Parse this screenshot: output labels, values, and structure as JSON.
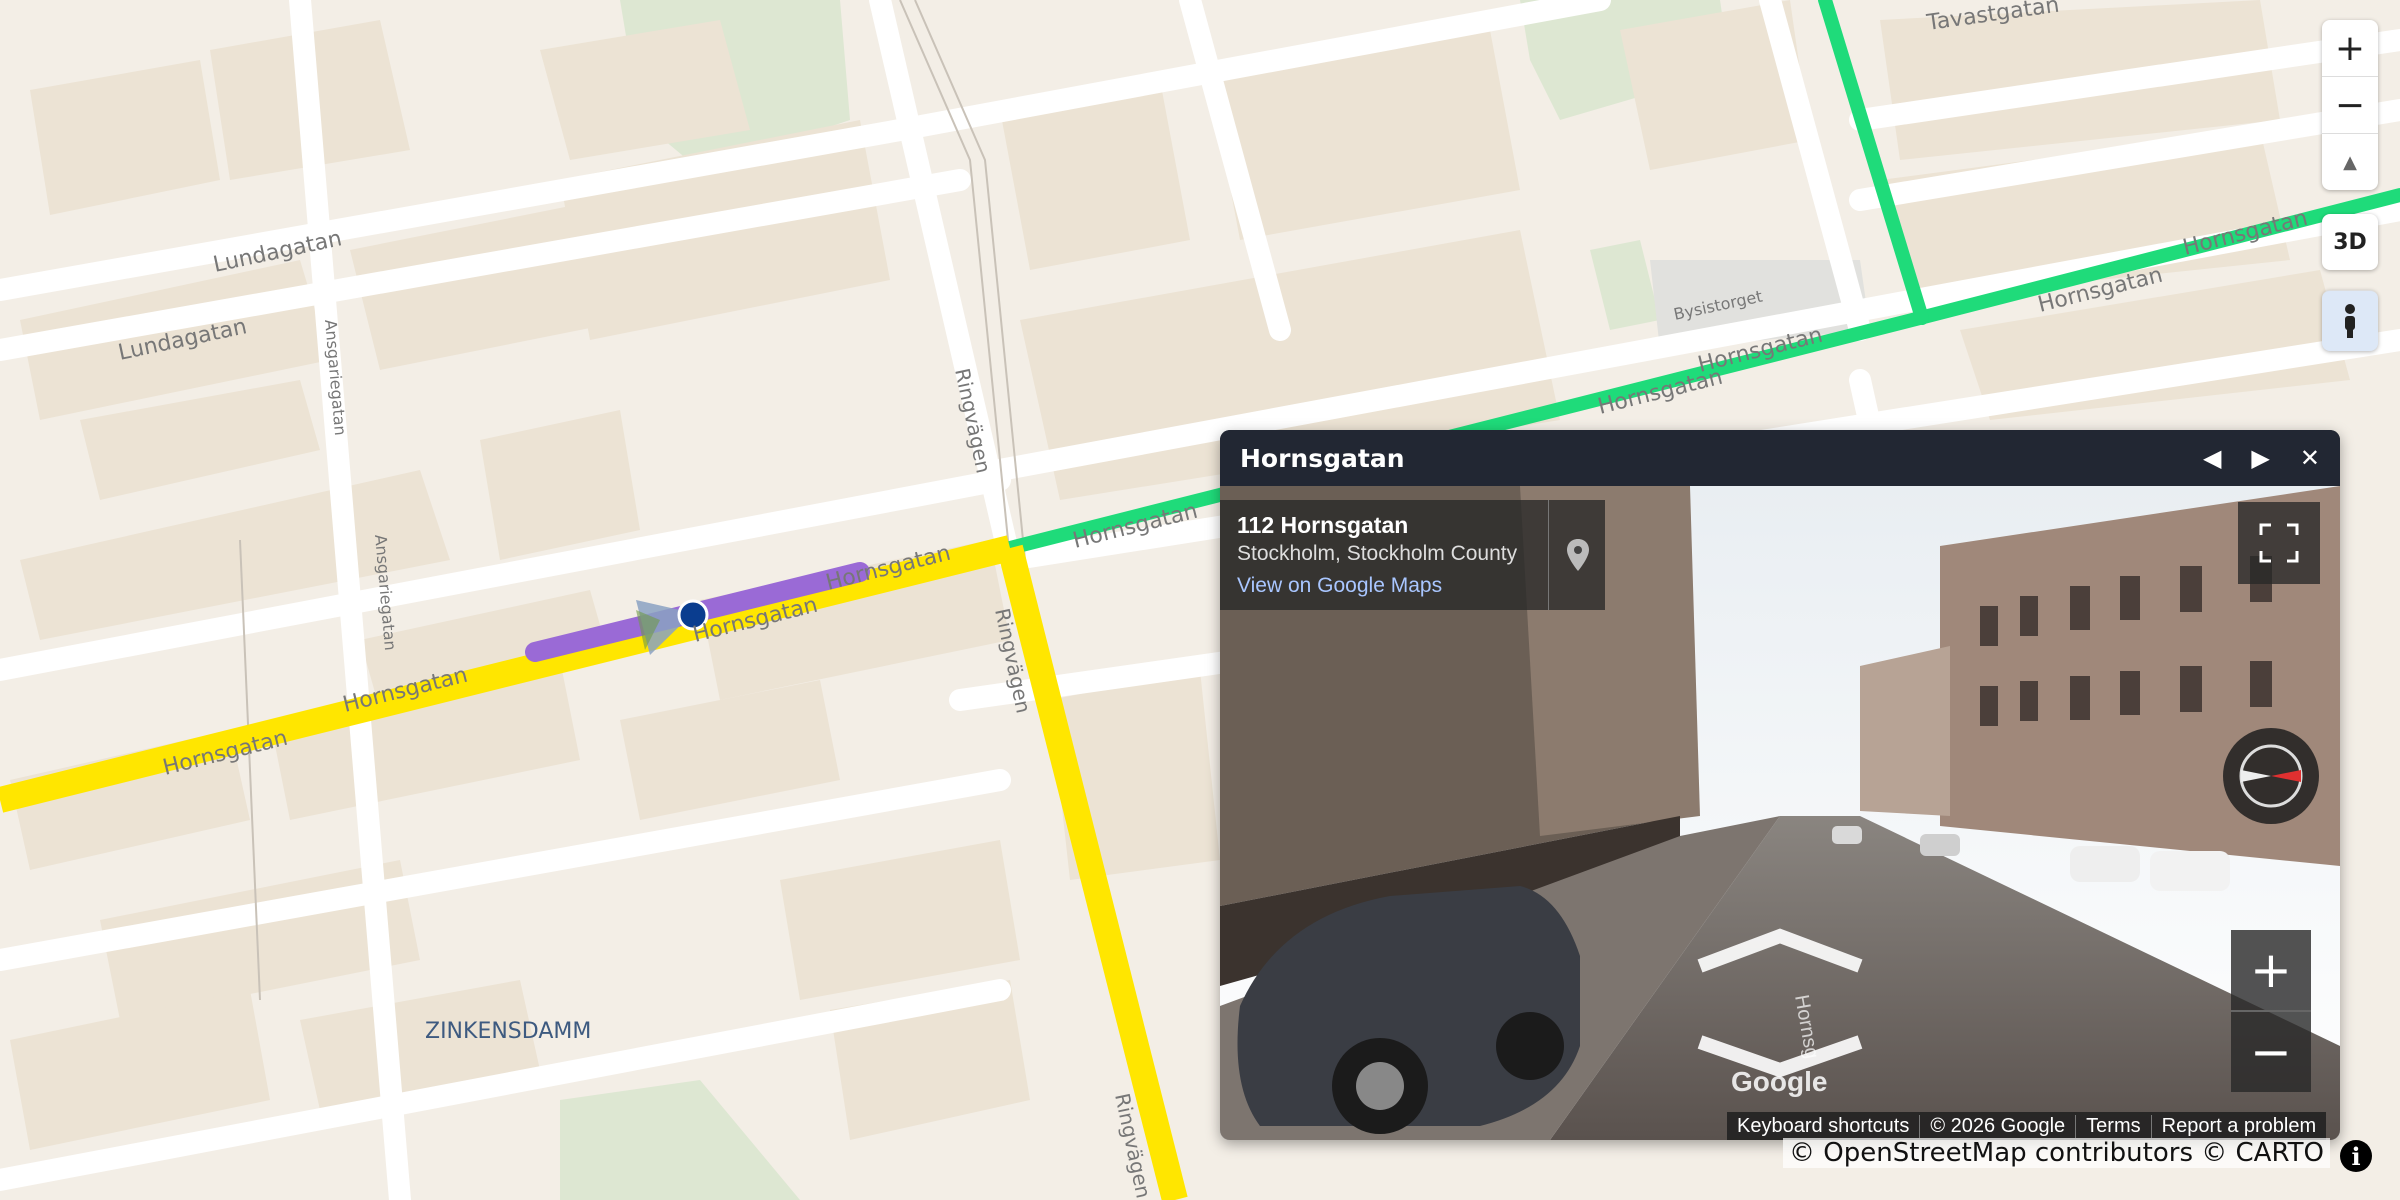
{
  "map": {
    "street_labels": [
      "Lundagatan",
      "Lundagatan",
      "Ansgariegatan",
      "Ansgariegatan",
      "Ringvägen",
      "Ringvägen",
      "Ringvägen",
      "Hornsgatan",
      "Hornsgatan",
      "Hornsgatan",
      "Hornsgatan",
      "Hornsgatan",
      "Hornsgatan",
      "Hornsgatan",
      "Hornsgatan",
      "Hornsgatan",
      "Tavastgatan",
      "Bysistorget",
      "ZINKENSDAMM"
    ],
    "colors": {
      "yellow_route": "#ffe600",
      "green_route": "#1fdb7a",
      "purple_route": "#9a6ad6",
      "marker": "#0a3d8f"
    }
  },
  "controls": {
    "zoom_in": "+",
    "zoom_out": "−",
    "reset_north": "▲",
    "three_d": "3D",
    "pegman_icon": "pegman-icon"
  },
  "panel": {
    "title": "Hornsgatan",
    "prev": "◀",
    "next": "▶",
    "close": "✕",
    "address_line1": "112 Hornsgatan",
    "address_line2": "Stockholm, Stockholm County",
    "view_link": "View on Google Maps",
    "google_logo": "Google",
    "street_arrow_label": "Hornsg",
    "zoom_in": "+",
    "zoom_out": "−",
    "footer": [
      "Keyboard shortcuts",
      "© 2026 Google",
      "Terms",
      "Report a problem"
    ]
  },
  "attribution": "© OpenStreetMap contributors © CARTO",
  "info": "i"
}
